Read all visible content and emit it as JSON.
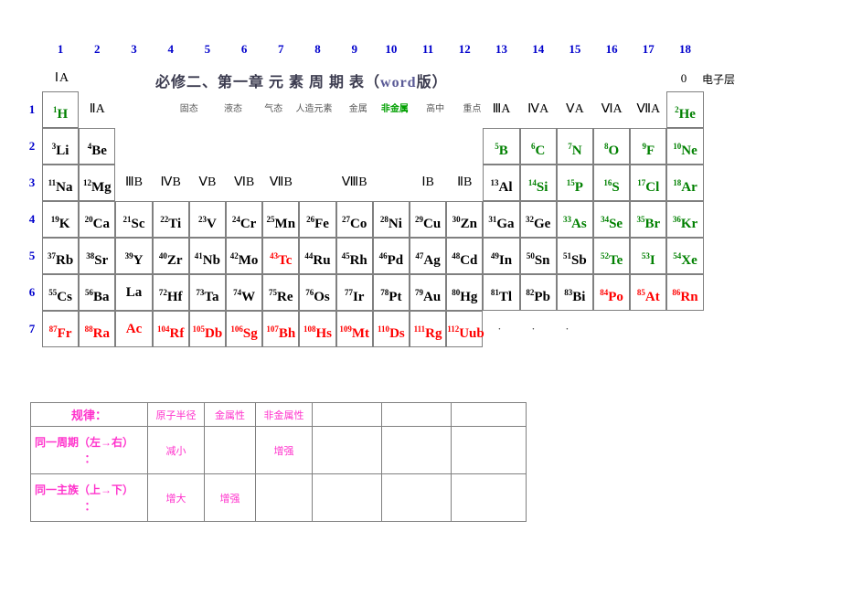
{
  "header": {
    "group_numbers": [
      "1",
      "2",
      "3",
      "4",
      "5",
      "6",
      "7",
      "8",
      "9",
      "10",
      "11",
      "12",
      "13",
      "14",
      "15",
      "16",
      "17",
      "18"
    ],
    "ia_label": "ⅠA",
    "title_main": "必修二、第一章  元  素  周  期  表（",
    "title_word": "word",
    "title_tail": "版）",
    "zero_label": "0",
    "shell_label": "电子层"
  },
  "legend": [
    {
      "label": "固态",
      "color": "#595959"
    },
    {
      "label": "液态",
      "color": "#595959"
    },
    {
      "label": "气态",
      "color": "#595959"
    },
    {
      "label": "人造元素",
      "color": "#595959"
    },
    {
      "label": "金属",
      "color": "#595959"
    },
    {
      "label": "非金属",
      "color": "#00a000"
    },
    {
      "label": "高中",
      "color": "#595959"
    },
    {
      "label": "重点",
      "color": "#595959"
    }
  ],
  "group_labels": {
    "iia": "ⅡA",
    "iiib": "ⅢB",
    "ivb": "ⅣB",
    "vb": "ⅤB",
    "vib": "ⅥB",
    "viib": "ⅦB",
    "viiib": "ⅧB",
    "ib": "ⅠB",
    "iib": "ⅡB",
    "iiia": "ⅢA",
    "iva": "ⅣA",
    "va": "ⅤA",
    "via": "ⅥA",
    "viia": "ⅦA"
  },
  "period_numbers": [
    "1",
    "2",
    "3",
    "4",
    "5",
    "6",
    "7"
  ],
  "elements": {
    "period1": [
      {
        "num": "1",
        "sym": "H",
        "color": "green",
        "col": 1
      },
      {
        "num": "2",
        "sym": "He",
        "color": "green",
        "col": 18
      }
    ],
    "period2": [
      {
        "num": "3",
        "sym": "Li",
        "color": "black",
        "col": 1
      },
      {
        "num": "4",
        "sym": "Be",
        "color": "black",
        "col": 2
      },
      {
        "num": "5",
        "sym": "B",
        "color": "green",
        "col": 13
      },
      {
        "num": "6",
        "sym": "C",
        "color": "green",
        "col": 14
      },
      {
        "num": "7",
        "sym": "N",
        "color": "green",
        "col": 15
      },
      {
        "num": "8",
        "sym": "O",
        "color": "green",
        "col": 16
      },
      {
        "num": "9",
        "sym": "F",
        "color": "green",
        "col": 17
      },
      {
        "num": "10",
        "sym": "Ne",
        "color": "green",
        "col": 18
      }
    ],
    "period3": [
      {
        "num": "11",
        "sym": "Na",
        "color": "black",
        "col": 1
      },
      {
        "num": "12",
        "sym": "Mg",
        "color": "black",
        "col": 2
      },
      {
        "num": "13",
        "sym": "Al",
        "color": "black",
        "col": 13
      },
      {
        "num": "14",
        "sym": "Si",
        "color": "green",
        "col": 14
      },
      {
        "num": "15",
        "sym": "P",
        "color": "green",
        "col": 15
      },
      {
        "num": "16",
        "sym": "S",
        "color": "green",
        "col": 16
      },
      {
        "num": "17",
        "sym": "Cl",
        "color": "green",
        "col": 17
      },
      {
        "num": "18",
        "sym": "Ar",
        "color": "green",
        "col": 18
      }
    ],
    "period4": [
      {
        "num": "19",
        "sym": "K",
        "color": "black",
        "col": 1
      },
      {
        "num": "20",
        "sym": "Ca",
        "color": "black",
        "col": 2
      },
      {
        "num": "21",
        "sym": "Sc",
        "color": "black",
        "col": 3
      },
      {
        "num": "22",
        "sym": "Ti",
        "color": "black",
        "col": 4
      },
      {
        "num": "23",
        "sym": "V",
        "color": "black",
        "col": 5
      },
      {
        "num": "24",
        "sym": "Cr",
        "color": "black",
        "col": 6
      },
      {
        "num": "25",
        "sym": "Mn",
        "color": "black",
        "col": 7
      },
      {
        "num": "26",
        "sym": "Fe",
        "color": "black",
        "col": 8
      },
      {
        "num": "27",
        "sym": "Co",
        "color": "black",
        "col": 9
      },
      {
        "num": "28",
        "sym": "Ni",
        "color": "black",
        "col": 10
      },
      {
        "num": "29",
        "sym": "Cu",
        "color": "black",
        "col": 11
      },
      {
        "num": "30",
        "sym": "Zn",
        "color": "black",
        "col": 12
      },
      {
        "num": "31",
        "sym": "Ga",
        "color": "black",
        "col": 13
      },
      {
        "num": "32",
        "sym": "Ge",
        "color": "black",
        "col": 14
      },
      {
        "num": "33",
        "sym": "As",
        "color": "green",
        "col": 15
      },
      {
        "num": "34",
        "sym": "Se",
        "color": "green",
        "col": 16
      },
      {
        "num": "35",
        "sym": "Br",
        "color": "green",
        "col": 17
      },
      {
        "num": "36",
        "sym": "Kr",
        "color": "green",
        "col": 18
      }
    ],
    "period5": [
      {
        "num": "37",
        "sym": "Rb",
        "color": "black",
        "col": 1
      },
      {
        "num": "38",
        "sym": "Sr",
        "color": "black",
        "col": 2
      },
      {
        "num": "39",
        "sym": "Y",
        "color": "black",
        "col": 3
      },
      {
        "num": "40",
        "sym": "Zr",
        "color": "black",
        "col": 4
      },
      {
        "num": "41",
        "sym": "Nb",
        "color": "black",
        "col": 5
      },
      {
        "num": "42",
        "sym": "Mo",
        "color": "black",
        "col": 6
      },
      {
        "num": "43",
        "sym": "Tc",
        "color": "red",
        "col": 7
      },
      {
        "num": "44",
        "sym": "Ru",
        "color": "black",
        "col": 8
      },
      {
        "num": "45",
        "sym": "Rh",
        "color": "black",
        "col": 9
      },
      {
        "num": "46",
        "sym": "Pd",
        "color": "black",
        "col": 10
      },
      {
        "num": "47",
        "sym": "Ag",
        "color": "black",
        "col": 11
      },
      {
        "num": "48",
        "sym": "Cd",
        "color": "black",
        "col": 12
      },
      {
        "num": "49",
        "sym": "In",
        "color": "black",
        "col": 13
      },
      {
        "num": "50",
        "sym": "Sn",
        "color": "black",
        "col": 14
      },
      {
        "num": "51",
        "sym": "Sb",
        "color": "black",
        "col": 15
      },
      {
        "num": "52",
        "sym": "Te",
        "color": "green",
        "col": 16
      },
      {
        "num": "53",
        "sym": "I",
        "color": "green",
        "col": 17
      },
      {
        "num": "54",
        "sym": "Xe",
        "color": "green",
        "col": 18
      }
    ],
    "period6": [
      {
        "num": "55",
        "sym": "Cs",
        "color": "black",
        "col": 1
      },
      {
        "num": "56",
        "sym": "Ba",
        "color": "black",
        "col": 2
      },
      {
        "num": "",
        "sym": "La",
        "color": "black",
        "col": 3
      },
      {
        "num": "72",
        "sym": "Hf",
        "color": "black",
        "col": 4
      },
      {
        "num": "73",
        "sym": "Ta",
        "color": "black",
        "col": 5
      },
      {
        "num": "74",
        "sym": "W",
        "color": "black",
        "col": 6
      },
      {
        "num": "75",
        "sym": "Re",
        "color": "black",
        "col": 7
      },
      {
        "num": "76",
        "sym": "Os",
        "color": "black",
        "col": 8
      },
      {
        "num": "77",
        "sym": "Ir",
        "color": "black",
        "col": 9
      },
      {
        "num": "78",
        "sym": "Pt",
        "color": "black",
        "col": 10
      },
      {
        "num": "79",
        "sym": "Au",
        "color": "black",
        "col": 11
      },
      {
        "num": "80",
        "sym": "Hg",
        "color": "black",
        "col": 12
      },
      {
        "num": "81",
        "sym": "Tl",
        "color": "black",
        "col": 13
      },
      {
        "num": "82",
        "sym": "Pb",
        "color": "black",
        "col": 14
      },
      {
        "num": "83",
        "sym": "Bi",
        "color": "black",
        "col": 15
      },
      {
        "num": "84",
        "sym": "Po",
        "color": "red",
        "col": 16
      },
      {
        "num": "85",
        "sym": "At",
        "color": "red",
        "col": 17
      },
      {
        "num": "86",
        "sym": "Rn",
        "color": "red",
        "col": 18
      }
    ],
    "period7": [
      {
        "num": "87",
        "sym": "Fr",
        "color": "red",
        "col": 1
      },
      {
        "num": "88",
        "sym": "Ra",
        "color": "red",
        "col": 2
      },
      {
        "num": "",
        "sym": "Ac",
        "color": "red",
        "col": 3
      },
      {
        "num": "104",
        "sym": "Rf",
        "color": "red",
        "col": 4
      },
      {
        "num": "105",
        "sym": "Db",
        "color": "red",
        "col": 5
      },
      {
        "num": "106",
        "sym": "Sg",
        "color": "red",
        "col": 6
      },
      {
        "num": "107",
        "sym": "Bh",
        "color": "red",
        "col": 7
      },
      {
        "num": "108",
        "sym": "Hs",
        "color": "red",
        "col": 8
      },
      {
        "num": "109",
        "sym": "Mt",
        "color": "red",
        "col": 9
      },
      {
        "num": "110",
        "sym": "Ds",
        "color": "red",
        "col": 10
      },
      {
        "num": "111",
        "sym": "Rg",
        "color": "red",
        "col": 11
      },
      {
        "num": "112",
        "sym": "Uub",
        "color": "red",
        "col": 12
      }
    ]
  },
  "trailing_dots": [
    "·",
    "·",
    "·"
  ],
  "rules_table": {
    "header": [
      "规律：",
      "原子半径",
      "金属性",
      "非金属性",
      "",
      "",
      ""
    ],
    "rows": [
      {
        "label": "同一周期（左→右）",
        "colon": "：",
        "cells": [
          "减小",
          "",
          "增强",
          "",
          "",
          ""
        ]
      },
      {
        "label": "同一主族（上→下）",
        "colon": "：",
        "cells": [
          "增大",
          "增强",
          "",
          "",
          "",
          ""
        ]
      }
    ]
  },
  "colors": {
    "metal_black": "#000000",
    "nonmetal_green": "#008000",
    "artificial_red": "#ff0000",
    "period_blue": "#0000cc",
    "rules_pink": "#ff33cc"
  }
}
